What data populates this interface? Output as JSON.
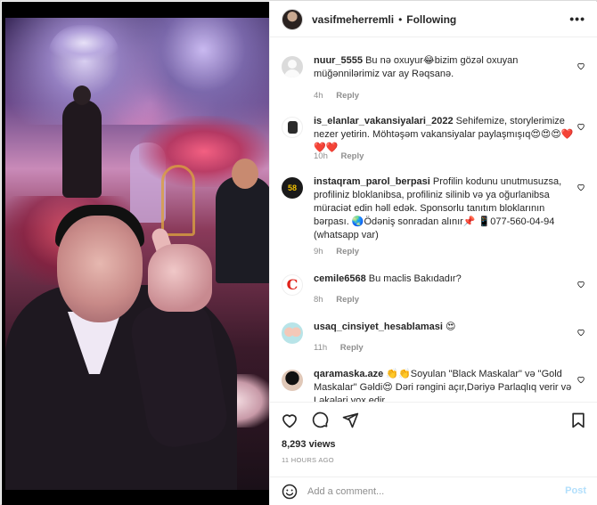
{
  "post": {
    "author": "vasifmeherremli",
    "follow_dot": "•",
    "follow_label": "Following",
    "more_label": "•••"
  },
  "comments": [
    {
      "username": "nuur_5555",
      "text": "Bu nə oxuyur😂bizim gözəl oxuyan müğənnilərimiz var ay Rəqsanə.",
      "time": "4h",
      "reply": "Reply",
      "avatar_icon": "default-avatar-icon"
    },
    {
      "username": "is_elanlar_vakansiyalari_2022",
      "text": "Sehifemize, storylerimize nezer yetirin. Möhtəşəm vakansiyalar paylaşmışıq😍😍😍❤️❤️❤️",
      "time": "10h",
      "reply": "Reply",
      "avatar_icon": "bot-avatar-icon"
    },
    {
      "username": "instaqram_parol_berpasi",
      "text": "Profilin kodunu unutmusuzsa, profiliniz bloklanibsa, profiliniz silinib və ya oğurlanibsa müraciət edin həll edək. Sponsorlu tanıtım bloklarının bərpası. 🌏Ödəniş sonradan alınır📌 📱077-560-04-94 (whatsapp var)",
      "time": "9h",
      "reply": "Reply",
      "avatar_icon": "logo-58-avatar-icon"
    },
    {
      "username": "cemile6568",
      "text": "Bu maclis Bakıdadır?",
      "time": "8h",
      "reply": "Reply",
      "avatar_icon": "letter-c-avatar-icon"
    },
    {
      "username": "usaq_cinsiyet_hesablamasi",
      "text": "😍",
      "time": "11h",
      "reply": "Reply",
      "avatar_icon": "couple-avatar-icon"
    },
    {
      "username": "qaramaska.aze",
      "text": "👏👏Soyulan \"Black Maskalar\" və \"Gold Maskalar\" Gəldi😍 Dəri rəngini açır,Dəriyə Parlaqlıq verir və Ləkələri yox edir",
      "time": "",
      "reply": "",
      "avatar_icon": "mask-avatar-icon"
    }
  ],
  "stats": {
    "views": "8,293 views",
    "time_ago": "11 HOURS AGO"
  },
  "add_comment": {
    "placeholder": "Add a comment...",
    "post_label": "Post"
  },
  "colors": {
    "text": "#262626",
    "muted": "#8e8e8e",
    "border": "#efefef",
    "post_disabled": "#b2dffc"
  }
}
